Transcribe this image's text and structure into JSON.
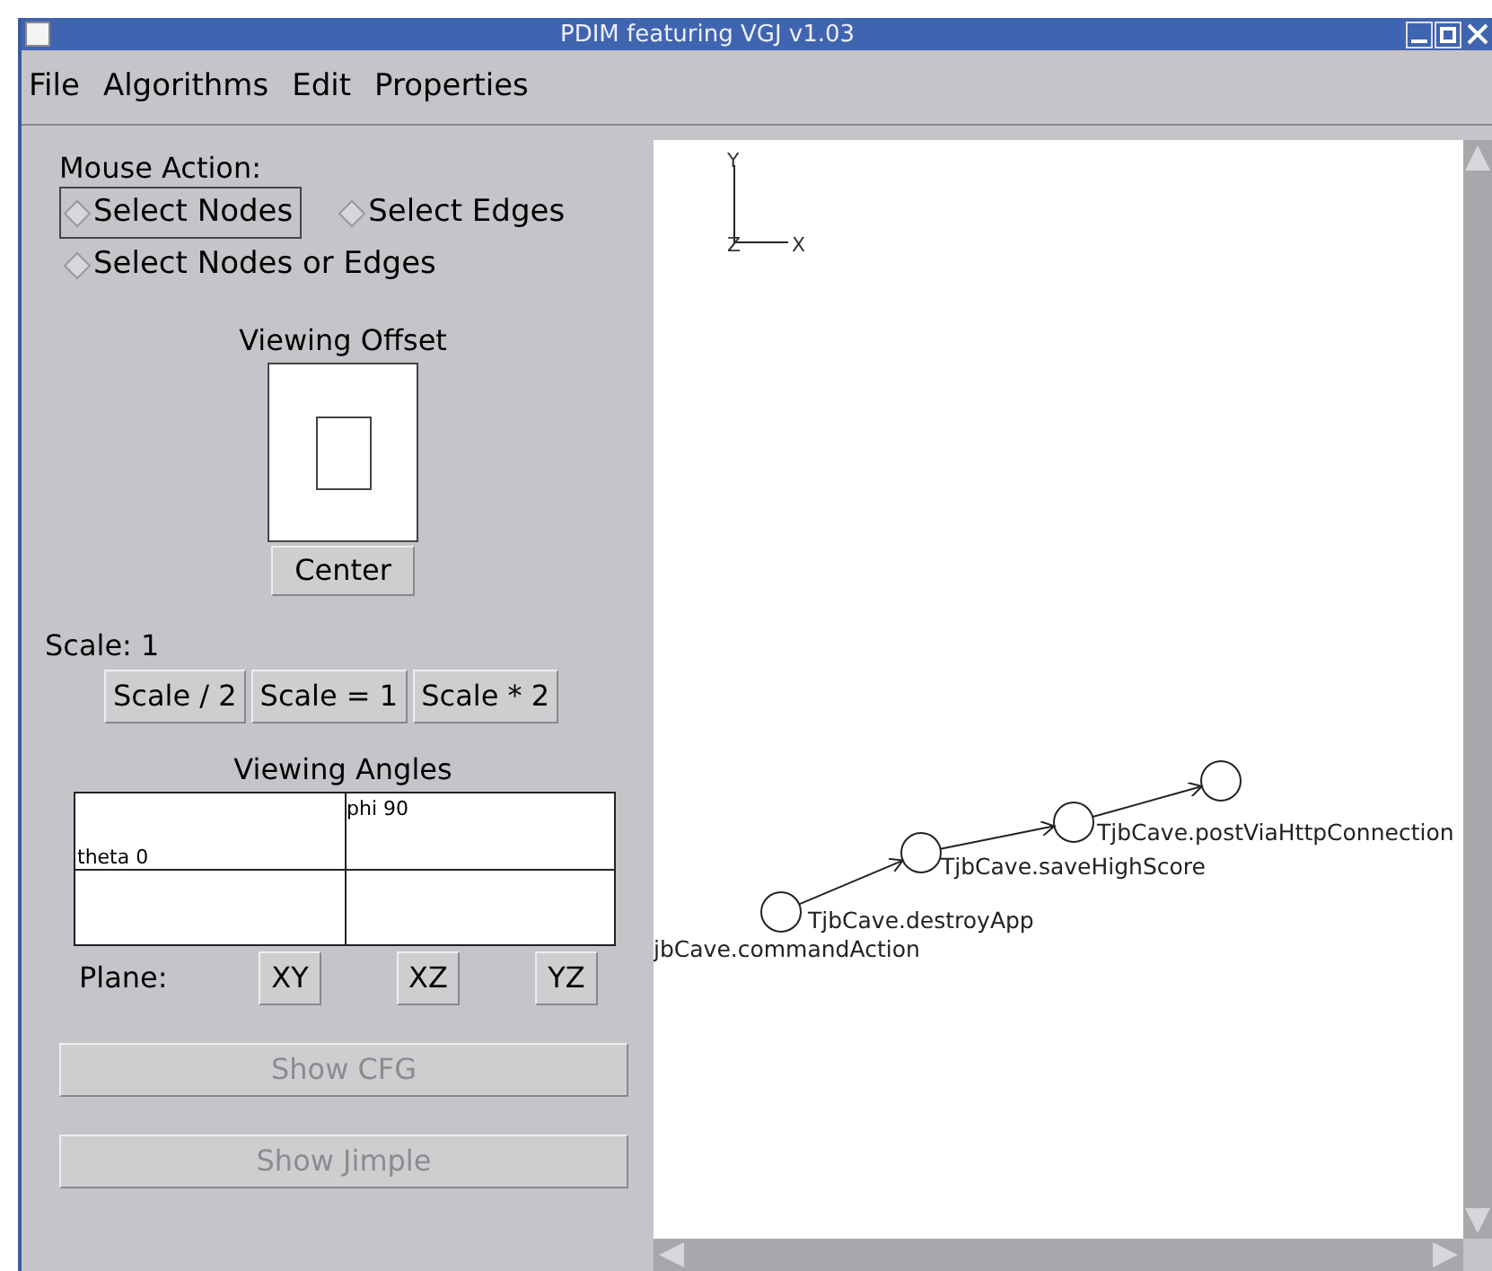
{
  "window": {
    "title": "PDIM featuring VGJ v1.03"
  },
  "menu": [
    "File",
    "Algorithms",
    "Edit",
    "Properties"
  ],
  "mouse_action": {
    "label": "Mouse Action:",
    "options": [
      {
        "label": "Select Nodes",
        "selected": false,
        "focused": true
      },
      {
        "label": "Select Edges",
        "selected": false,
        "focused": false
      },
      {
        "label": "Select Nodes or Edges",
        "selected": false,
        "focused": false
      }
    ]
  },
  "viewing_offset": {
    "title": "Viewing Offset",
    "button": "Center"
  },
  "scale": {
    "label": "Scale: 1",
    "buttons": [
      "Scale / 2",
      "Scale = 1",
      "Scale * 2"
    ]
  },
  "viewing_angles": {
    "title": "Viewing Angles",
    "phi": "phi 90",
    "theta": "theta 0"
  },
  "plane": {
    "label": "Plane:",
    "buttons": [
      "XY",
      "XZ",
      "YZ"
    ]
  },
  "actions": [
    {
      "label": "Show CFG",
      "disabled": true
    },
    {
      "label": "Show Jimple",
      "disabled": true
    }
  ],
  "canvas": {
    "axes": {
      "y": "Y",
      "z": "Z",
      "x": "X"
    },
    "nodes": [
      {
        "label": "jbCave.commandAction"
      },
      {
        "label": "TjbCave.destroyApp"
      },
      {
        "label": "TjbCave.saveHighScore"
      },
      {
        "label": "TjbCave.postViaHttpConnection"
      }
    ]
  }
}
